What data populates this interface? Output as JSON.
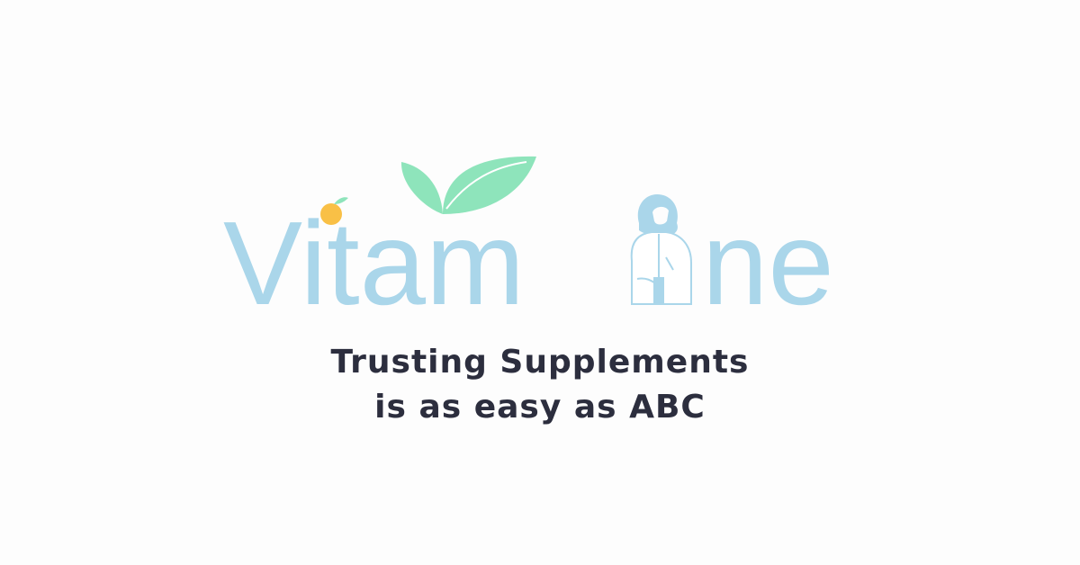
{
  "logo": {
    "text_1": "Vitam",
    "text_2": "ne",
    "icons": [
      "leaf-sprout-icon",
      "orange-fruit-icon",
      "doctor-figure-icon"
    ],
    "colors": {
      "wordmark": "#aad6ea",
      "leaf": "#8ee4bb",
      "orange": "#f9c046",
      "doctor": "#aad6ea"
    }
  },
  "tagline": {
    "line_1": "Trusting Supplements",
    "line_2": "is as easy as ABC",
    "color": "#2c2e3e"
  },
  "background": "#fdfdfd"
}
